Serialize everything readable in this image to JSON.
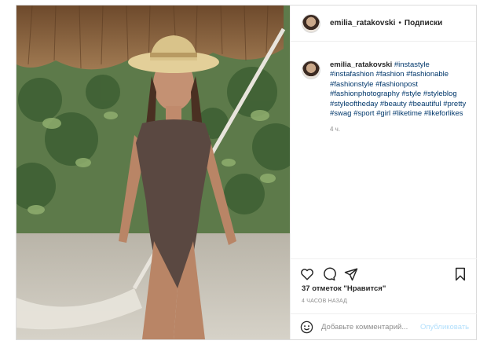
{
  "post": {
    "username": "emilia_ratakovski",
    "separator": "•",
    "follow_label": "Подписки",
    "caption": {
      "username": "emilia_ratakovski",
      "hashtags": "#instastyle #instafashion #fashion #fashionable #fashionstyle #fashionpost #fashionphotography #style #styleblog #styleoftheday #beauty #beautiful #pretty #swag #sport #girl #liketime #likeforlikes",
      "time": "4 ч."
    },
    "likes": "37 отметок \"Нравится\"",
    "posted": "4 ЧАСОВ НАЗАД",
    "comment": {
      "placeholder": "Добавьте комментарий...",
      "value": "",
      "publish_label": "Опубликовать"
    }
  },
  "colors": {
    "link": "#00376b",
    "muted": "#8e8e8e",
    "publish_disabled": "#b2dffc",
    "border": "#dbdbdb"
  },
  "icons": [
    "heart-icon",
    "comment-icon",
    "share-icon",
    "bookmark-icon",
    "emoji-icon"
  ]
}
